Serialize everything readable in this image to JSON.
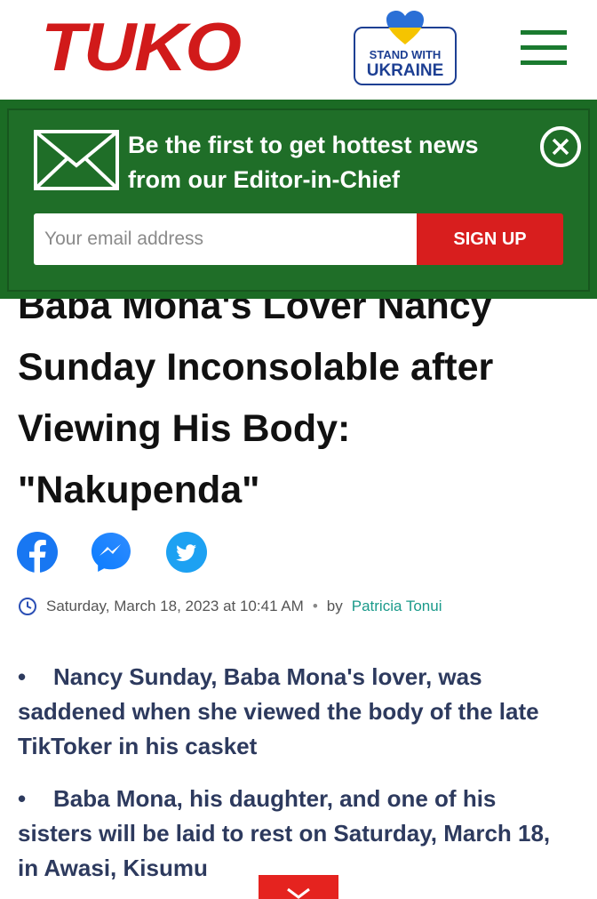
{
  "header": {
    "logo": "TUKO",
    "ukraine_line1": "STAND WITH",
    "ukraine_line2": "UKRAINE",
    "menu_icon": "hamburger-icon"
  },
  "newsletter": {
    "message": "Be the first to get hottest news from our Editor-in-Chief",
    "email_placeholder": "Your email address",
    "signup_label": "SIGN UP",
    "icons": [
      "mail-icon",
      "close-icon"
    ]
  },
  "article": {
    "title": "Baba Mona's Lover Nancy Sunday Inconsolable after Viewing His Body: \"Nakupenda\"",
    "share_icons": [
      "facebook-icon",
      "messenger-icon",
      "twitter-icon"
    ],
    "date": "Saturday, March 18, 2023 at 10:41 AM",
    "separator": "•",
    "by_label": "by",
    "author": "Patricia Tonui",
    "bullets": [
      "Nancy Sunday, Baba Mona's lover, was saddened when she viewed the body of the late TikToker in his casket",
      "Baba Mona, his daughter, and one of his sisters will be laid to rest on Saturday, March 18, in Awasi, Kisumu"
    ],
    "bullet_mark": "•"
  },
  "colors": {
    "brand_red": "#d11a1a",
    "banner_green": "#1b6b24",
    "signup_red": "#d81e1e",
    "bullet_text": "#2d3a5e",
    "author_link": "#1a9a8a"
  }
}
